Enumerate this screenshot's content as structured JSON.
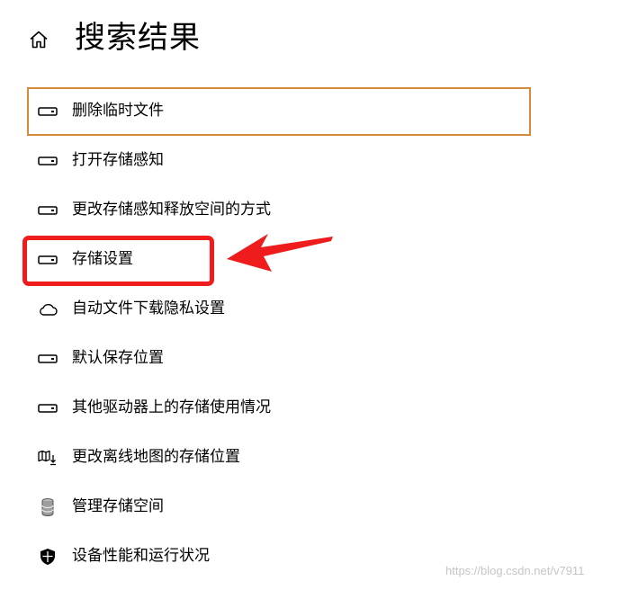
{
  "header": {
    "title": "搜索结果",
    "home_icon": "home-icon"
  },
  "results": [
    {
      "label": "删除临时文件",
      "icon": "drive-icon",
      "focused": true
    },
    {
      "label": "打开存储感知",
      "icon": "drive-icon"
    },
    {
      "label": "更改存储感知释放空间的方式",
      "icon": "drive-icon"
    },
    {
      "label": "存储设置",
      "icon": "drive-icon",
      "highlighted": true
    },
    {
      "label": "自动文件下载隐私设置",
      "icon": "cloud-icon"
    },
    {
      "label": "默认保存位置",
      "icon": "drive-icon"
    },
    {
      "label": "其他驱动器上的存储使用情况",
      "icon": "drive-icon"
    },
    {
      "label": "更改离线地图的存储位置",
      "icon": "map-download-icon"
    },
    {
      "label": "管理存储空间",
      "icon": "storage-pool-icon"
    },
    {
      "label": "设备性能和运行状况",
      "icon": "shield-icon"
    }
  ],
  "annotation": {
    "color": "#ee1c1c",
    "focus_color": "#d48a3a"
  },
  "watermark": "https://blog.csdn.net/v7911"
}
